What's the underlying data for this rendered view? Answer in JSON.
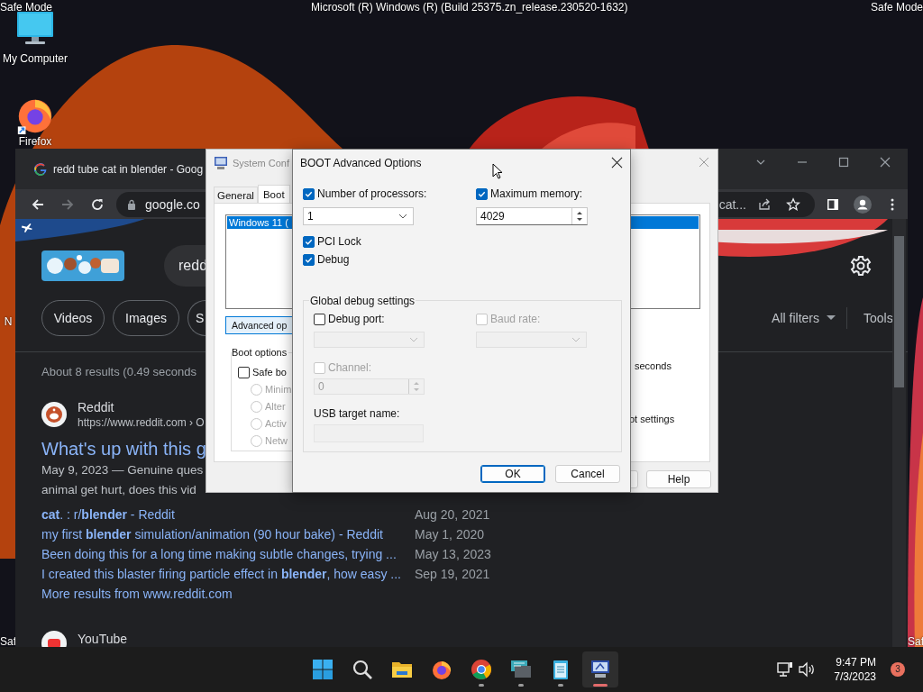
{
  "desktop": {
    "labels": [
      {
        "kind": "top_left",
        "text": "Safe Mode"
      },
      {
        "kind": "top_center",
        "text": "Microsoft (R) Windows (R) (Build 25375.zn_release.230520-1632)"
      },
      {
        "kind": "top_right",
        "text": "Safe Mode"
      },
      {
        "kind": "bottom_left",
        "text": "Saf"
      },
      {
        "kind": "bottom_right",
        "text": "Saf"
      }
    ],
    "icons": [
      {
        "kind": "computer",
        "label": "My Computer"
      },
      {
        "kind": "firefox",
        "label": "Firefox"
      },
      {
        "kind": "partial",
        "label": "N"
      }
    ]
  },
  "browser": {
    "tab_title": "redd tube cat in blender - Goog",
    "address": "google.co",
    "address_tail": "cat...",
    "search_query": "redd",
    "chips": [
      {
        "label": "Videos"
      },
      {
        "label": "Images"
      },
      {
        "label": "S"
      }
    ],
    "all_filters": "All filters",
    "tools": "Tools",
    "result_stats": "About 8 results (0.49 seconds",
    "result": {
      "site": "Reddit",
      "url": "https://www.reddit.com › O",
      "title": "What's up with this g",
      "snippet": "May 9, 2023 — Genuine ques",
      "snippet_line_2": "animal get hurt, does this vid",
      "sublinks": [
        {
          "text": "**cat**. : r/**blender** - Reddit",
          "date": "Aug 20, 2021"
        },
        {
          "text": "my first **blender** simulation/animation (90 hour bake) - Reddit",
          "date": "May 1, 2020"
        },
        {
          "text": "Been doing this for a long time making subtle changes, trying ...",
          "date": "May 13, 2023"
        },
        {
          "text": "I created this blaster firing particle effect in **blender**, how easy ...",
          "date": "Sep 19, 2021"
        }
      ],
      "more": "More results from www.reddit.com"
    },
    "next_result": {
      "site": "YouTube"
    }
  },
  "system_configuration": {
    "title": "System Conf",
    "tabs": [
      {
        "label": "General",
        "selected": false
      },
      {
        "label": "Boot",
        "selected": true
      }
    ],
    "boot_entries": [
      {
        "label": "Windows 11 (",
        "selected": true
      }
    ],
    "advanced_button": "Advanced op",
    "boot_options_label": "Boot options",
    "safe_boot": {
      "label": "Safe bo",
      "checked": false
    },
    "safe_boot_modes": [
      {
        "label": "Minim",
        "selected": false,
        "disabled": true
      },
      {
        "label": "Alter",
        "selected": false,
        "disabled": true
      },
      {
        "label": "Activ",
        "selected": false,
        "disabled": true
      },
      {
        "label": "Netw",
        "selected": false,
        "disabled": true
      }
    ],
    "timeout_unit": "seconds",
    "settings_tail": "ot settings",
    "help_button": "Help"
  },
  "boot_advanced_options": {
    "title": "BOOT Advanced Options",
    "processors": {
      "label": "Number of processors:",
      "checked": true,
      "value": "1"
    },
    "memory": {
      "label": "Maximum memory:",
      "checked": true,
      "value": "4029"
    },
    "options": [
      {
        "label": "PCI Lock",
        "checked": true
      },
      {
        "label": "Debug",
        "checked": true
      }
    ],
    "debug_settings": {
      "label": "Global debug settings",
      "debug_port": {
        "label": "Debug port:",
        "checked": false,
        "disabled": false
      },
      "baud_rate": {
        "label": "Baud rate:",
        "checked": false,
        "disabled": true
      },
      "channel": {
        "label": "Channel:",
        "checked": false,
        "disabled": true,
        "value": "0"
      },
      "usb_target": {
        "label": "USB target name:"
      }
    },
    "buttons": [
      {
        "label": "OK",
        "default": true
      },
      {
        "label": "Cancel",
        "default": false
      }
    ]
  },
  "taskbar": {
    "apps": [
      {
        "kind": "start",
        "running": false,
        "active": false
      },
      {
        "kind": "search",
        "running": false,
        "active": false
      },
      {
        "kind": "explorer",
        "running": false,
        "active": false
      },
      {
        "kind": "firefox",
        "running": false,
        "active": false
      },
      {
        "kind": "chrome",
        "running": true,
        "active": false
      },
      {
        "kind": "remote",
        "running": true,
        "active": false
      },
      {
        "kind": "notepad",
        "running": true,
        "active": false
      },
      {
        "kind": "msconfig",
        "running": true,
        "active": true
      }
    ],
    "time": "9:47 PM",
    "date": "7/3/2023",
    "notifications": "3"
  }
}
